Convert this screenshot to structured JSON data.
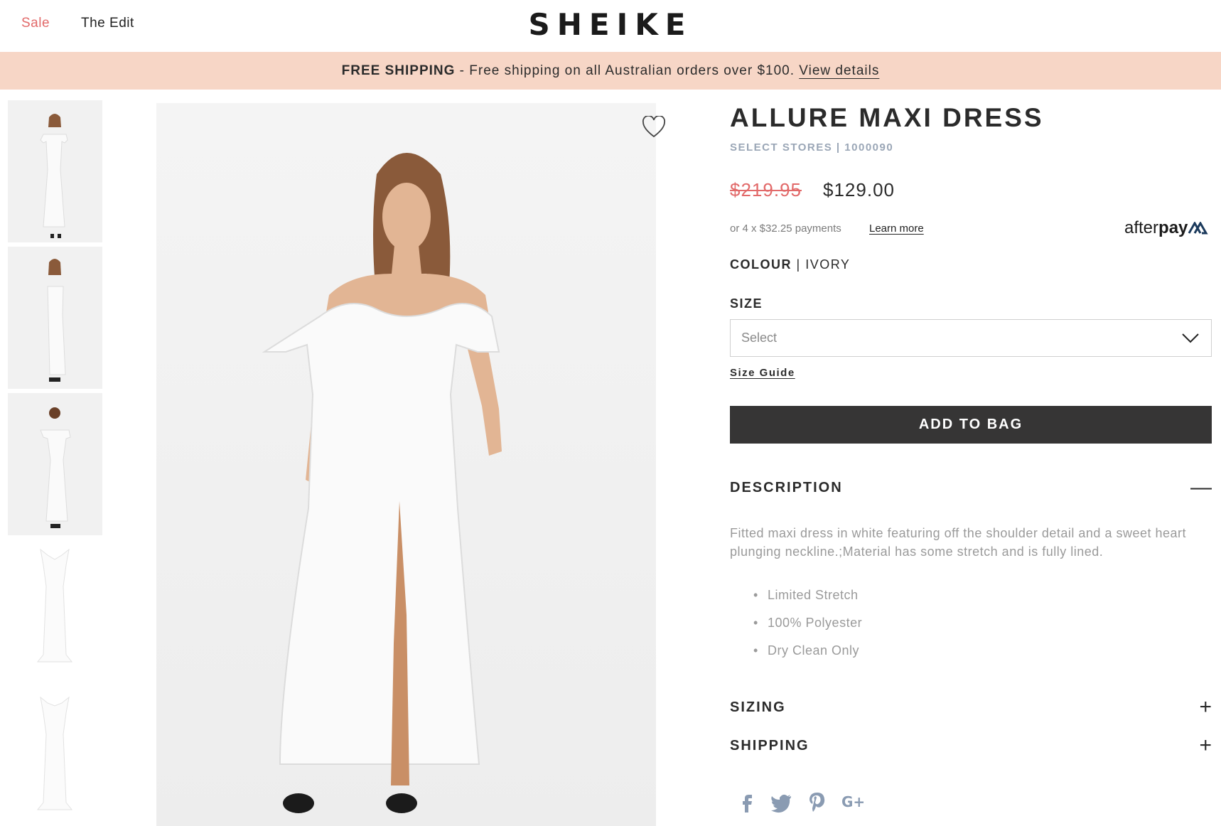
{
  "header": {
    "nav": [
      {
        "label": "Sale",
        "color": "#e26a6a"
      },
      {
        "label": "The Edit"
      }
    ],
    "logo": "SHEIKE"
  },
  "banner": {
    "bold": "FREE SHIPPING",
    "text": " - Free shipping on all Australian orders over $100. ",
    "link": "View details",
    "bg": "#f7d6c6"
  },
  "gallery": {
    "thumbnail_count": 5,
    "icons": {
      "wishlist": "heart-outline-icon"
    }
  },
  "product": {
    "title": "ALLURE MAXI DRESS",
    "availability": "SELECT STORES",
    "sku_separator": " | ",
    "sku": "1000090",
    "price_old": "$219.95",
    "price_new": "$129.00",
    "afterpay_text": "or 4 x $32.25 payments",
    "afterpay_link": "Learn more",
    "afterpay_logo_light": "after",
    "afterpay_logo_bold": "pay",
    "colour_label": "COLOUR",
    "colour_separator": " | ",
    "colour_value": "IVORY",
    "size_label": "SIZE",
    "size_placeholder": "Select",
    "size_guide": "Size Guide",
    "add_to_bag": "ADD TO BAG",
    "accent_sale": "#e26a6a",
    "button_bg": "#363535"
  },
  "accordion": {
    "description": {
      "title": "DESCRIPTION",
      "symbol": "—",
      "text": "Fitted maxi dress in white featuring off the shoulder detail and a sweet heart plunging neckline.;Material has some stretch and is fully lined.",
      "bullets": [
        "Limited Stretch",
        "100% Polyester",
        "Dry Clean Only"
      ]
    },
    "sizing": {
      "title": "SIZING",
      "symbol": "+"
    },
    "shipping": {
      "title": "SHIPPING",
      "symbol": "+"
    }
  },
  "social": [
    "facebook-icon",
    "twitter-icon",
    "pinterest-icon",
    "google-plus-icon"
  ]
}
